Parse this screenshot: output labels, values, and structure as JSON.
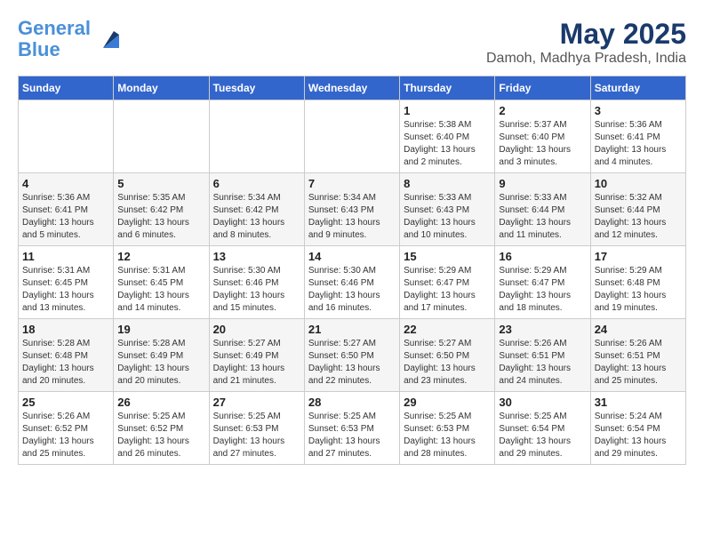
{
  "header": {
    "logo_line1": "General",
    "logo_line2": "Blue",
    "title": "May 2025",
    "subtitle": "Damoh, Madhya Pradesh, India"
  },
  "weekdays": [
    "Sunday",
    "Monday",
    "Tuesday",
    "Wednesday",
    "Thursday",
    "Friday",
    "Saturday"
  ],
  "weeks": [
    [
      {
        "day": "",
        "info": ""
      },
      {
        "day": "",
        "info": ""
      },
      {
        "day": "",
        "info": ""
      },
      {
        "day": "",
        "info": ""
      },
      {
        "day": "1",
        "info": "Sunrise: 5:38 AM\nSunset: 6:40 PM\nDaylight: 13 hours\nand 2 minutes."
      },
      {
        "day": "2",
        "info": "Sunrise: 5:37 AM\nSunset: 6:40 PM\nDaylight: 13 hours\nand 3 minutes."
      },
      {
        "day": "3",
        "info": "Sunrise: 5:36 AM\nSunset: 6:41 PM\nDaylight: 13 hours\nand 4 minutes."
      }
    ],
    [
      {
        "day": "4",
        "info": "Sunrise: 5:36 AM\nSunset: 6:41 PM\nDaylight: 13 hours\nand 5 minutes."
      },
      {
        "day": "5",
        "info": "Sunrise: 5:35 AM\nSunset: 6:42 PM\nDaylight: 13 hours\nand 6 minutes."
      },
      {
        "day": "6",
        "info": "Sunrise: 5:34 AM\nSunset: 6:42 PM\nDaylight: 13 hours\nand 8 minutes."
      },
      {
        "day": "7",
        "info": "Sunrise: 5:34 AM\nSunset: 6:43 PM\nDaylight: 13 hours\nand 9 minutes."
      },
      {
        "day": "8",
        "info": "Sunrise: 5:33 AM\nSunset: 6:43 PM\nDaylight: 13 hours\nand 10 minutes."
      },
      {
        "day": "9",
        "info": "Sunrise: 5:33 AM\nSunset: 6:44 PM\nDaylight: 13 hours\nand 11 minutes."
      },
      {
        "day": "10",
        "info": "Sunrise: 5:32 AM\nSunset: 6:44 PM\nDaylight: 13 hours\nand 12 minutes."
      }
    ],
    [
      {
        "day": "11",
        "info": "Sunrise: 5:31 AM\nSunset: 6:45 PM\nDaylight: 13 hours\nand 13 minutes."
      },
      {
        "day": "12",
        "info": "Sunrise: 5:31 AM\nSunset: 6:45 PM\nDaylight: 13 hours\nand 14 minutes."
      },
      {
        "day": "13",
        "info": "Sunrise: 5:30 AM\nSunset: 6:46 PM\nDaylight: 13 hours\nand 15 minutes."
      },
      {
        "day": "14",
        "info": "Sunrise: 5:30 AM\nSunset: 6:46 PM\nDaylight: 13 hours\nand 16 minutes."
      },
      {
        "day": "15",
        "info": "Sunrise: 5:29 AM\nSunset: 6:47 PM\nDaylight: 13 hours\nand 17 minutes."
      },
      {
        "day": "16",
        "info": "Sunrise: 5:29 AM\nSunset: 6:47 PM\nDaylight: 13 hours\nand 18 minutes."
      },
      {
        "day": "17",
        "info": "Sunrise: 5:29 AM\nSunset: 6:48 PM\nDaylight: 13 hours\nand 19 minutes."
      }
    ],
    [
      {
        "day": "18",
        "info": "Sunrise: 5:28 AM\nSunset: 6:48 PM\nDaylight: 13 hours\nand 20 minutes."
      },
      {
        "day": "19",
        "info": "Sunrise: 5:28 AM\nSunset: 6:49 PM\nDaylight: 13 hours\nand 20 minutes."
      },
      {
        "day": "20",
        "info": "Sunrise: 5:27 AM\nSunset: 6:49 PM\nDaylight: 13 hours\nand 21 minutes."
      },
      {
        "day": "21",
        "info": "Sunrise: 5:27 AM\nSunset: 6:50 PM\nDaylight: 13 hours\nand 22 minutes."
      },
      {
        "day": "22",
        "info": "Sunrise: 5:27 AM\nSunset: 6:50 PM\nDaylight: 13 hours\nand 23 minutes."
      },
      {
        "day": "23",
        "info": "Sunrise: 5:26 AM\nSunset: 6:51 PM\nDaylight: 13 hours\nand 24 minutes."
      },
      {
        "day": "24",
        "info": "Sunrise: 5:26 AM\nSunset: 6:51 PM\nDaylight: 13 hours\nand 25 minutes."
      }
    ],
    [
      {
        "day": "25",
        "info": "Sunrise: 5:26 AM\nSunset: 6:52 PM\nDaylight: 13 hours\nand 25 minutes."
      },
      {
        "day": "26",
        "info": "Sunrise: 5:25 AM\nSunset: 6:52 PM\nDaylight: 13 hours\nand 26 minutes."
      },
      {
        "day": "27",
        "info": "Sunrise: 5:25 AM\nSunset: 6:53 PM\nDaylight: 13 hours\nand 27 minutes."
      },
      {
        "day": "28",
        "info": "Sunrise: 5:25 AM\nSunset: 6:53 PM\nDaylight: 13 hours\nand 27 minutes."
      },
      {
        "day": "29",
        "info": "Sunrise: 5:25 AM\nSunset: 6:53 PM\nDaylight: 13 hours\nand 28 minutes."
      },
      {
        "day": "30",
        "info": "Sunrise: 5:25 AM\nSunset: 6:54 PM\nDaylight: 13 hours\nand 29 minutes."
      },
      {
        "day": "31",
        "info": "Sunrise: 5:24 AM\nSunset: 6:54 PM\nDaylight: 13 hours\nand 29 minutes."
      }
    ]
  ]
}
